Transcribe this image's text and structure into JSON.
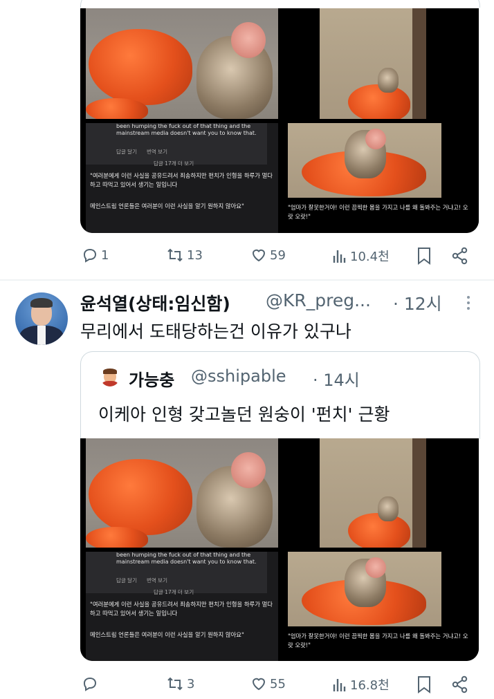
{
  "tweet1": {
    "captions": {
      "left_english": "been humping the fuck out of that thing and the mainstream media doesn't want you to know that.",
      "left_reply": "답글 달기",
      "left_translate": "번역 보기",
      "left_more_replies": "답글 17개 더 보기",
      "left_korean_1": "\"여러분에게 이런 사실을 공유드려서 죄송하지만 펀치가 인형을 하루가 멀다 하고 따먹고 있어서 생기는 일입니다",
      "left_korean_2": "메인스트림 언론들은 여러분이 이런 사실을 알기 원하지 않아요\"",
      "right_korean": "\"엄마가 잘못한거야! 이런 끔찍한 몸을 가지고 나를 왜 돌봐주는 거냐고! 오랏 오랏!\""
    },
    "actions": {
      "reply_count": "1",
      "repost_count": "13",
      "like_count": "59",
      "view_count": "10.4천"
    }
  },
  "tweet2": {
    "author_name": "윤석열(상태:임신함)",
    "handle": "@KR_preg...",
    "time": "· 12시",
    "text": "무리에서 도태당하는건 이유가 있구나",
    "quote": {
      "author_name": "가능충",
      "handle": "@sshipable",
      "time": "· 14시",
      "text": "이케아 인형 갖고놀던 원숭이 '펀치' 근황"
    },
    "captions": {
      "left_english": "been humping the fuck out of that thing and the mainstream media doesn't want you to know that.",
      "left_reply": "답글 달기",
      "left_translate": "번역 보기",
      "left_more_replies": "답글 17개 더 보기",
      "left_korean_1": "\"여러분에게 이런 사실을 공유드려서 죄송하지만 펀치가 인형을 하루가 멀다 하고 따먹고 있어서 생기는 일입니다",
      "left_korean_2": "메인스트림 언론들은 여러분이 이런 사실을 알기 원하지 않아요\"",
      "right_korean": "\"엄마가 잘못한거야! 이런 끔찍한 몸을 가지고 나를 왜 돌봐주는 거냐고! 오랏 오랏!\""
    },
    "actions": {
      "reply_count": "",
      "repost_count": "3",
      "like_count": "55",
      "view_count": "16.8천"
    }
  },
  "icons": [
    "reply-icon",
    "repost-icon",
    "like-icon",
    "views-icon",
    "bookmark-icon",
    "share-icon",
    "more-icon"
  ],
  "colors": {
    "icon_gray": "#536471",
    "text": "#0f1419",
    "border": "#cfd9de"
  }
}
